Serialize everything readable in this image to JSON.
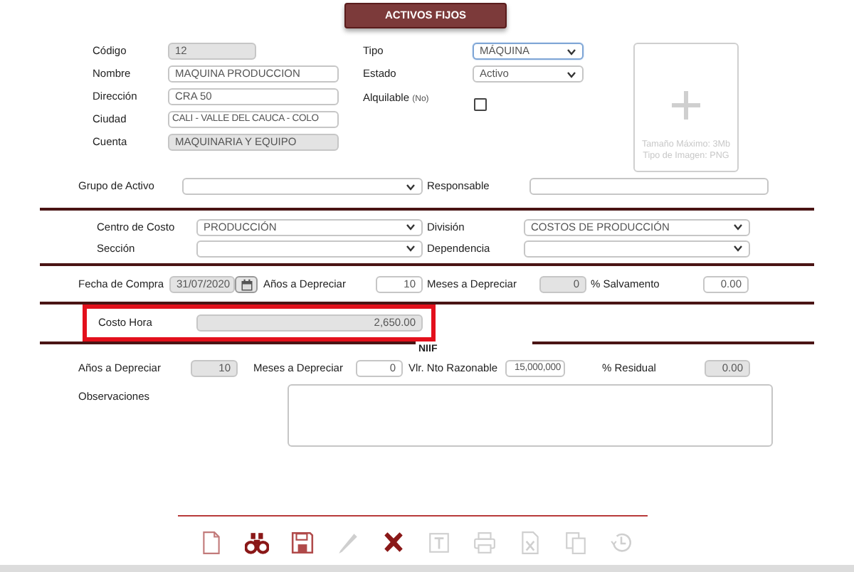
{
  "title": "ACTIVOS FIJOS",
  "general": {
    "codigo": {
      "label": "Código",
      "value": "12",
      "disabled": true
    },
    "nombre": {
      "label": "Nombre",
      "value": "MAQUINA PRODUCCION",
      "disabled": false
    },
    "direccion": {
      "label": "Dirección",
      "value": "CRA 50",
      "disabled": false
    },
    "ciudad": {
      "label": "Ciudad",
      "value": "CALI - VALLE DEL CAUCA - COLO",
      "disabled": false
    },
    "cuenta": {
      "label": "Cuenta",
      "value": "MAQUINARIA Y EQUIPO",
      "disabled": true
    },
    "tipo": {
      "label": "Tipo",
      "value": "MÁQUINA",
      "focused": true
    },
    "estado": {
      "label": "Estado",
      "value": "Activo",
      "focused": false
    },
    "alquilable": {
      "label": "Alquilable",
      "hint": "(No)",
      "checked": false
    },
    "image": {
      "lines": [
        "Tamaño Máximo: 3Mb",
        "Tipo de Imagen: PNG"
      ]
    }
  },
  "grupo_activo": {
    "label": "Grupo de Activo",
    "focused": false
  },
  "responsable": {
    "label": "Responsable",
    "disabled": false
  },
  "centro_costo": {
    "label": "Centro de Costo",
    "value": "PRODUCCIÓN",
    "focused": false
  },
  "division": {
    "label": "División",
    "value": "COSTOS DE PRODUCCIÓN",
    "focused": false
  },
  "seccion": {
    "label": "Sección",
    "focused": false
  },
  "dependencia": {
    "label": "Dependencia",
    "focused": false
  },
  "fecha_compra": {
    "label": "Fecha de Compra",
    "value": "31/07/2020",
    "disabled": true
  },
  "anos_depreciar": {
    "label": "Años a Depreciar",
    "value": "10",
    "disabled": false
  },
  "meses_depreciar": {
    "label": "Meses a Depreciar",
    "value": "0",
    "disabled": true
  },
  "salvamento": {
    "label": "% Salvamento",
    "value": "0.00",
    "disabled": false
  },
  "costo_hora": {
    "label": "Costo Hora",
    "value": "2,650.00",
    "disabled": true,
    "highlighted": true
  },
  "niif": {
    "title": "NIIF",
    "anos": {
      "label": "Años a Depreciar",
      "value": "10",
      "disabled": true
    },
    "meses": {
      "label": "Meses a Depreciar",
      "value": "0",
      "disabled": false
    },
    "vlr": {
      "label": "Vlr. Nto Razonable",
      "value": "15,000,000",
      "disabled": false
    },
    "residual": {
      "label": "% Residual",
      "value": "0.00",
      "disabled": true
    }
  },
  "observaciones": {
    "label": "Observaciones"
  },
  "toolbar": [
    {
      "kind": "new",
      "enabled": true
    },
    {
      "kind": "search",
      "enabled": true
    },
    {
      "kind": "save",
      "enabled": true
    },
    {
      "kind": "edit",
      "enabled": false
    },
    {
      "kind": "delete",
      "enabled": true
    },
    {
      "kind": "text",
      "enabled": false
    },
    {
      "kind": "print",
      "enabled": false
    },
    {
      "kind": "excel",
      "enabled": false
    },
    {
      "kind": "copy",
      "enabled": false
    },
    {
      "kind": "history",
      "enabled": false
    }
  ]
}
